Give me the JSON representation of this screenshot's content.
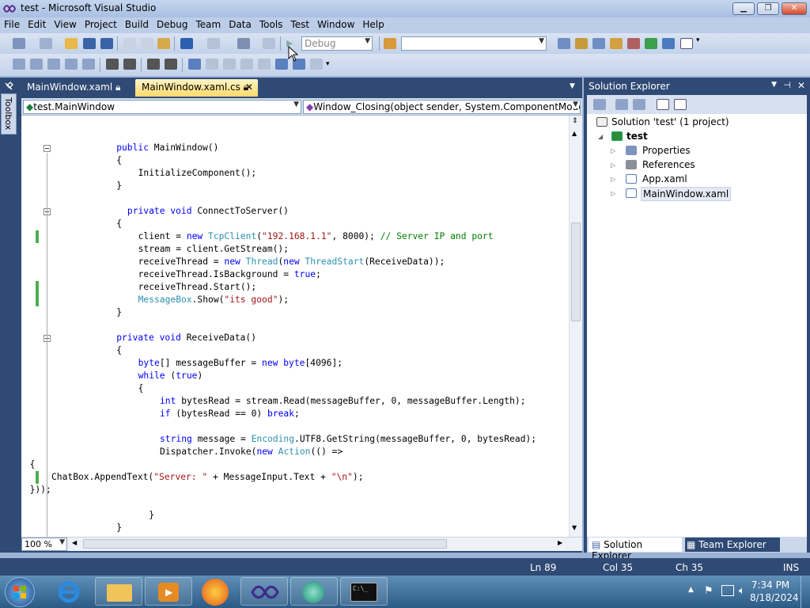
{
  "window": {
    "title": "test - Microsoft Visual Studio"
  },
  "menu": [
    "File",
    "Edit",
    "View",
    "Project",
    "Build",
    "Debug",
    "Team",
    "Data",
    "Tools",
    "Test",
    "Window",
    "Help"
  ],
  "toolbar": {
    "config": "Debug",
    "find_value": ""
  },
  "tabs": [
    {
      "label": "MainWindow.xaml",
      "icon": "lock-icon",
      "active": false
    },
    {
      "label": "MainWindow.xaml.cs",
      "icon": "lock-icon",
      "active": true
    }
  ],
  "nav": {
    "class_combo": "test.MainWindow",
    "member_combo": "Window_Closing(object sender, System.ComponentModel.("
  },
  "code_lines": [
    {
      "indent": 6,
      "parts": [
        [
          "kw",
          "public "
        ],
        [
          "n",
          "MainWindow()"
        ]
      ]
    },
    {
      "indent": 6,
      "parts": [
        [
          "n",
          "{"
        ]
      ]
    },
    {
      "indent": 8,
      "parts": [
        [
          "n",
          "InitializeComponent();"
        ]
      ]
    },
    {
      "indent": 6,
      "parts": [
        [
          "n",
          "}"
        ]
      ]
    },
    {
      "indent": 0,
      "parts": []
    },
    {
      "indent": 7,
      "parts": [
        [
          "kw",
          "private void "
        ],
        [
          "n",
          "ConnectToServer()"
        ]
      ]
    },
    {
      "indent": 6,
      "parts": [
        [
          "n",
          "{"
        ]
      ]
    },
    {
      "indent": 8,
      "parts": [
        [
          "n",
          "client = "
        ],
        [
          "kw",
          "new "
        ],
        [
          "ty",
          "TcpClient"
        ],
        [
          "n",
          "("
        ],
        [
          "st",
          "\"192.168.1.1\""
        ],
        [
          "n",
          ", 8000); "
        ],
        [
          "cm",
          "// Server IP and port"
        ]
      ]
    },
    {
      "indent": 8,
      "parts": [
        [
          "n",
          "stream = client.GetStream();"
        ]
      ]
    },
    {
      "indent": 8,
      "parts": [
        [
          "n",
          "receiveThread = "
        ],
        [
          "kw",
          "new "
        ],
        [
          "ty",
          "Thread"
        ],
        [
          "n",
          "("
        ],
        [
          "kw",
          "new "
        ],
        [
          "ty",
          "ThreadStart"
        ],
        [
          "n",
          "(ReceiveData));"
        ]
      ]
    },
    {
      "indent": 8,
      "parts": [
        [
          "n",
          "receiveThread.IsBackground = "
        ],
        [
          "kw",
          "true"
        ],
        [
          "n",
          ";"
        ]
      ]
    },
    {
      "indent": 8,
      "parts": [
        [
          "n",
          "receiveThread.Start();"
        ]
      ]
    },
    {
      "indent": 8,
      "parts": [
        [
          "ty",
          "MessageBox"
        ],
        [
          "n",
          ".Show("
        ],
        [
          "st",
          "\"its good\""
        ],
        [
          "n",
          ");"
        ]
      ]
    },
    {
      "indent": 6,
      "parts": [
        [
          "n",
          "}"
        ]
      ]
    },
    {
      "indent": 0,
      "parts": []
    },
    {
      "indent": 6,
      "parts": [
        [
          "kw",
          "private void "
        ],
        [
          "n",
          "ReceiveData()"
        ]
      ]
    },
    {
      "indent": 6,
      "parts": [
        [
          "n",
          "{"
        ]
      ]
    },
    {
      "indent": 8,
      "parts": [
        [
          "kw",
          "byte"
        ],
        [
          "n",
          "[] messageBuffer = "
        ],
        [
          "kw",
          "new byte"
        ],
        [
          "n",
          "[4096];"
        ]
      ]
    },
    {
      "indent": 8,
      "parts": [
        [
          "kw",
          "while "
        ],
        [
          "n",
          "("
        ],
        [
          "kw",
          "true"
        ],
        [
          "n",
          ")"
        ]
      ]
    },
    {
      "indent": 8,
      "parts": [
        [
          "n",
          "{"
        ]
      ]
    },
    {
      "indent": 10,
      "parts": [
        [
          "kw",
          "int "
        ],
        [
          "n",
          "bytesRead = stream.Read(messageBuffer, 0, messageBuffer.Length);"
        ]
      ]
    },
    {
      "indent": 10,
      "parts": [
        [
          "kw",
          "if "
        ],
        [
          "n",
          "(bytesRead == 0) "
        ],
        [
          "kw",
          "break"
        ],
        [
          "n",
          ";"
        ]
      ]
    },
    {
      "indent": 0,
      "parts": []
    },
    {
      "indent": 10,
      "parts": [
        [
          "kw",
          "string "
        ],
        [
          "n",
          "message = "
        ],
        [
          "ty",
          "Encoding"
        ],
        [
          "n",
          ".UTF8.GetString(messageBuffer, 0, bytesRead);"
        ]
      ]
    },
    {
      "indent": 10,
      "parts": [
        [
          "n",
          "Dispatcher.Invoke("
        ],
        [
          "kw",
          "new "
        ],
        [
          "ty",
          "Action"
        ],
        [
          "n",
          "(() =>"
        ]
      ]
    },
    {
      "indent": -2,
      "parts": [
        [
          "n",
          "{"
        ]
      ]
    },
    {
      "indent": 0,
      "parts": [
        [
          "n",
          "ChatBox.AppendText("
        ],
        [
          "st",
          "\"Server: \""
        ],
        [
          "n",
          " + MessageInput.Text + "
        ],
        [
          "st",
          "\"\\n\""
        ],
        [
          "n",
          ");"
        ]
      ]
    },
    {
      "indent": -2,
      "parts": [
        [
          "n",
          "}));"
        ]
      ]
    },
    {
      "indent": 0,
      "parts": []
    },
    {
      "indent": 9,
      "parts": [
        [
          "n",
          "}"
        ]
      ]
    },
    {
      "indent": 6,
      "parts": [
        [
          "n",
          "}"
        ]
      ]
    }
  ],
  "zoom": "100 %",
  "solution_explorer": {
    "title": "Solution Explorer",
    "solution": "Solution 'test' (1 project)",
    "project": "test",
    "items": [
      "Properties",
      "References",
      "App.xaml",
      "MainWindow.xaml"
    ],
    "tabs": [
      "Solution Explorer",
      "Team Explorer"
    ]
  },
  "toolbox_label": "Toolbox",
  "status": {
    "ln": "Ln 89",
    "col": "Col 35",
    "ch": "Ch 35",
    "mode": "INS"
  },
  "clock": {
    "time": "7:34 PM",
    "date": "8/18/2024"
  }
}
